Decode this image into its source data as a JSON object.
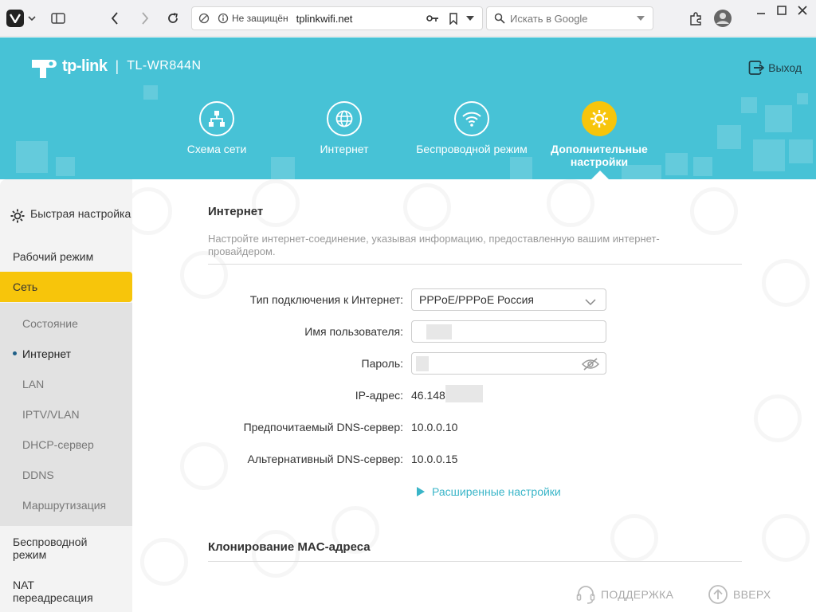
{
  "browser": {
    "security_label": "Не защищён",
    "url": "tplinkwifi.net",
    "search_placeholder": "Искать в Google"
  },
  "header": {
    "brand": "tp-link",
    "separator": "|",
    "model": "TL-WR844N",
    "logout_label": "Выход",
    "nav": [
      {
        "label": "Схема сети",
        "icon": "network-map-icon"
      },
      {
        "label": "Интернет",
        "icon": "globe-icon"
      },
      {
        "label": "Беспроводной режим",
        "icon": "wifi-icon"
      },
      {
        "label": "Дополнительные настройки",
        "icon": "gear-icon",
        "active": true
      }
    ]
  },
  "sidebar": {
    "quick_setup": "Быстрая настройка",
    "mode": "Рабочий режим",
    "network": "Сеть",
    "sub_items": [
      "Состояние",
      "Интернет",
      "LAN",
      "IPTV/VLAN",
      "DHCP-сервер",
      "DDNS",
      "Маршрутизация"
    ],
    "current_sub": "Интернет",
    "wireless": "Беспроводной режим",
    "nat": "NAT переадресация"
  },
  "internet": {
    "title": "Интернет",
    "description": "Настройте интернет-соединение, указывая информацию, предоставленную вашим интернет-провайдером.",
    "conn_type_label": "Тип подключения к Интернет:",
    "conn_type_value": "PPPoE/PPPoE Россия",
    "username_label": "Имя пользователя:",
    "password_label": "Пароль:",
    "ip_label": "IP-адрес:",
    "ip_value": "46.148",
    "dns1_label": "Предпочитаемый DNS-сервер:",
    "dns1_value": "10.0.0.10",
    "dns2_label": "Альтернативный DNS-сервер:",
    "dns2_value": "10.0.0.15",
    "advanced_label": "Расширенные настройки"
  },
  "mac_clone": {
    "title": "Клонирование MAC-адреса"
  },
  "footer": {
    "support_label": "ПОДДЕРЖКА",
    "top_label": "ВВЕРХ"
  },
  "colors": {
    "header_bg": "#47c2d6",
    "accent_yellow": "#f7c50b",
    "link_blue": "#39b5c8"
  }
}
